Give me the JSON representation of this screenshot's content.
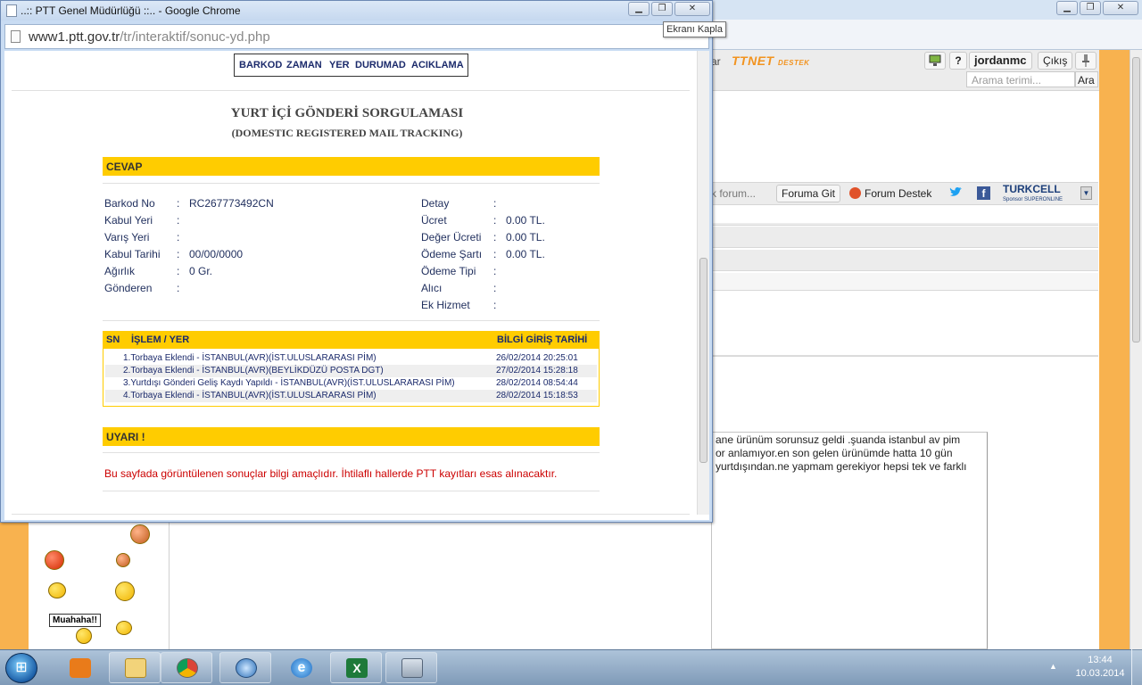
{
  "background_browser": {
    "site_logo": "TTNET",
    "site_logo_suffix": "DESTEK",
    "fragment_text": "ar",
    "help_label": "?",
    "username": "jordanmc",
    "logout": "Çıkış",
    "search_placeholder": "Arama terimi...",
    "search_button": "Ara",
    "forum_search_placeholder": "k forum...",
    "forum_go_button": "Foruma Git",
    "forum_support_link": "Forum Destek",
    "sponsor_name": "TURKCELL",
    "sponsor_sub": "Sponsor SUPERONLINE",
    "post_lines": [
      "ane ürünüm sorunsuz geldi .şuanda istanbul av pim",
      "or anlamıyor.en son gelen ürünümde hatta 10 gün",
      "yurtdışından.ne yapmam gerekiyor hepsi tek ve farklı"
    ],
    "muahaha": "Muahaha!!"
  },
  "popup": {
    "window_title": "..:: PTT Genel Müdürlüğü ::.. - Google Chrome",
    "url_host": "www1.ptt.gov.tr",
    "url_path": "/tr/interaktif/sonuc-yd.php",
    "tooltip": "Ekranı Kapla",
    "menu": [
      "BARKOD",
      "ZAMAN",
      "YER",
      "DURUMAD",
      "ACIKLAMA"
    ],
    "title": "YURT İÇİ GÖNDERİ SORGULAMASI",
    "subtitle": "(DOMESTIC REGISTERED MAIL TRACKING)",
    "answer_header": "CEVAP",
    "left_fields": [
      {
        "label": "Barkod No",
        "sep": ":",
        "value": "RC267773492CN"
      },
      {
        "label": "Kabul Yeri",
        "sep": ":",
        "value": ""
      },
      {
        "label": "Varış Yeri",
        "sep": ":",
        "value": ""
      },
      {
        "label": "Kabul Tarihi",
        "sep": ":",
        "value": "00/00/0000"
      },
      {
        "label": "Ağırlık",
        "sep": ":",
        "value": "0 Gr."
      },
      {
        "label": "Gönderen",
        "sep": ":",
        "value": ""
      }
    ],
    "right_fields": [
      {
        "label": "Detay",
        "sep": ":",
        "value": ""
      },
      {
        "label": "Ücret",
        "sep": ":",
        "value": "0.00 TL."
      },
      {
        "label": "Değer Ücreti",
        "sep": ":",
        "value": "0.00 TL."
      },
      {
        "label": "Ödeme Şartı",
        "sep": ":",
        "value": "0.00 TL."
      },
      {
        "label": "Ödeme Tipi",
        "sep": ":",
        "value": ""
      },
      {
        "label": "Alıcı",
        "sep": ":",
        "value": ""
      },
      {
        "label": "Ek Hizmet",
        "sep": ":",
        "value": ""
      }
    ],
    "table_headers": {
      "sn": "SN",
      "islem": "İŞLEM / YER",
      "tarih": "BİLGİ GİRİŞ TARİHİ"
    },
    "table_rows": [
      {
        "desc": "1.Torbaya Eklendi - İSTANBUL(AVR)(İST.ULUSLARARASI PİM)",
        "date": "26/02/2014 20:25:01"
      },
      {
        "desc": "2.Torbaya Eklendi - İSTANBUL(AVR)(BEYLİKDÜZÜ POSTA DGT)",
        "date": "27/02/2014 15:28:18"
      },
      {
        "desc": "3.Yurtdışı Gönderi Geliş Kaydı Yapıldı - İSTANBUL(AVR)(İST.ULUSLARARASI PİM)",
        "date": "28/02/2014 08:54:44"
      },
      {
        "desc": "4.Torbaya Eklendi - İSTANBUL(AVR)(İST.ULUSLARARASI PİM)",
        "date": "28/02/2014 15:18:53"
      }
    ],
    "warning_header": "UYARI !",
    "warning_text": "Bu sayfada görüntülenen sonuçlar bilgi amaçlıdır. İhtilaflı hallerde PTT kayıtları esas alınacaktır."
  },
  "taskbar": {
    "time": "13:44",
    "date": "10.03.2014",
    "apps": [
      "media-player-icon",
      "file-explorer-icon",
      "chrome-icon",
      "itunes-icon",
      "internet-explorer-icon",
      "excel-icon",
      "calculator-icon"
    ]
  },
  "colors": {
    "accent_yellow": "#ffcc00",
    "warning_red": "#cc0000",
    "text_navy": "#1e2d5c"
  }
}
